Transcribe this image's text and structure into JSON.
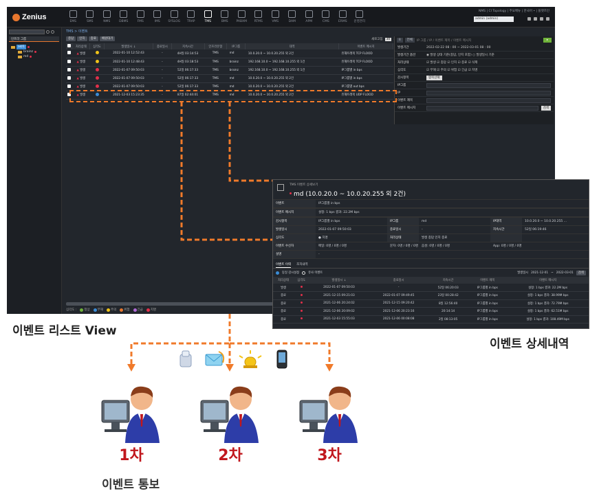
{
  "app": {
    "logo": "Zenius",
    "nav": [
      "EMS",
      "SMS",
      "NMS",
      "DBMS",
      "FMS",
      "IMS",
      "SYSLOG",
      "TRAP",
      "TMS",
      "BMS",
      "PABXM",
      "RTMS",
      "VMS",
      "DAM",
      "APM",
      "CMS",
      "ERMS",
      "운영관리"
    ],
    "active_nav": "TMS",
    "top_links": "NMS | CI Topology | 주요메뉴 | 한국어 • | 플랫즈인",
    "user": "admin (admin)",
    "sidebar_tab": "인프라 그룹",
    "tree": {
      "root": "ad/1",
      "children": [
        "brainz",
        "md"
      ]
    },
    "breadcrumb": "TMS > 이벤트",
    "filter_buttons": [
      "종답",
      "인지",
      "종료",
      "배원대기"
    ],
    "refresh_label": "새로고침",
    "refresh_value": "30",
    "refresh_unit": "초",
    "columns": [
      "처리상태",
      "심각도",
      "발생일시 ↓",
      "종료일시",
      "지속시간",
      "인프라유형",
      "IP그룹",
      "대역",
      "이벤트 메시지"
    ],
    "rows": [
      {
        "status": "발생",
        "color": "#f0c419",
        "time": "2022-01-10 12:52:43",
        "end": "-",
        "dur": "4H일 03:14:53",
        "type": "TMS",
        "ip": "md",
        "band": "10.0.20.0 ~ 10.0.20.255 외 2건",
        "msg": "유해트래픽 TCP FLOOD"
      },
      {
        "status": "발생",
        "color": "#f0c419",
        "time": "2022-01-10 12:48:43",
        "end": "-",
        "dur": "4H일 03:18:53",
        "type": "TMS",
        "ip": "brainz",
        "band": "192.168.10.0 ~ 192.168.10.255 외 1건",
        "msg": "유해트래픽 TCP FLOOD"
      },
      {
        "status": "발생",
        "color": "#e2304a",
        "time": "2022-01-07 09:50:03",
        "end": "-",
        "dur": "52일 06:17:33",
        "type": "TMS",
        "ip": "brainz",
        "band": "192.168.10.0 ~ 192.168.10.255 외 1건",
        "msg": "IP그룹별 in bps"
      },
      {
        "status": "발생",
        "color": "#e2304a",
        "time": "2022-01-07 09:50:03",
        "end": "-",
        "dur": "52일 06:17:33",
        "type": "TMS",
        "ip": "md",
        "band": "10.0.20.0 ~ 10.0.20.255 외 2건",
        "msg": "IP그룹별 in bps"
      },
      {
        "status": "발생",
        "color": "#e2304a",
        "time": "2022-01-07 09:50:03",
        "end": "-",
        "dur": "52일 06:17:33",
        "type": "TMS",
        "ip": "md",
        "band": "10.0.20.0 ~ 10.0.20.255 외 2건",
        "msg": "IP그룹별 out bps"
      },
      {
        "status": "발생",
        "color": "#3b8cd6",
        "time": "2021-12-03 15:23:35",
        "end": "-",
        "dur": "87일 02:44:01",
        "type": "TMS",
        "ip": "md",
        "band": "10.0.20.0 ~ 10.0.20.255 외 2건",
        "msg": "유해트래픽 UDP FLOOD"
      }
    ],
    "legend_label": "심각도 :",
    "legend": [
      {
        "label": "정상",
        "color": "#6fb23a"
      },
      {
        "label": "무해",
        "color": "#3b8cd6"
      },
      {
        "label": "주의",
        "color": "#f0c419"
      },
      {
        "label": "위험",
        "color": "#e8772e"
      },
      {
        "label": "긴급",
        "color": "#b06ad6"
      },
      {
        "label": "치명",
        "color": "#e2304a"
      }
    ]
  },
  "search_panel": {
    "top_filter": "전체",
    "top_placeholder": "IP 그룹 / IP / 이벤트 제목 / 이벤트 메시지",
    "fields": [
      {
        "label": "발생기간",
        "value": "2022-02-22  08 : 00  ~  2022-03-01  08 : 00"
      },
      {
        "label": "발생기간 옵션",
        "value": "◉ 발생 상태 기준(종답, 인지 포함)  ○ 발생일시 기준"
      },
      {
        "label": "처리상태",
        "value": "☑ 발생  ☑ 종답  ☑ 인지  ☑ 종료  ☑ 삭제"
      },
      {
        "label": "심각도",
        "value": "☑ 무해  ☑ 주의  ☑ 위험  ☑ 긴급  ☑ 치명"
      },
      {
        "label": "감시항목",
        "value": "항목선택"
      },
      {
        "label": "IP그룹",
        "value": ""
      },
      {
        "label": "IP",
        "value": ""
      },
      {
        "label": "이벤트 제목",
        "value": ""
      },
      {
        "label": "이벤트 메시지",
        "value": ""
      }
    ],
    "search_button": "검색"
  },
  "detail": {
    "window_title": "TMS 이벤트 상세보기",
    "title": "md (10.0.20.0 ~ 10.0.20.255 외 2건)",
    "rows": [
      [
        "이벤트",
        "IP그룹별 in bps"
      ],
      [
        "이벤트 메시지",
        "설정: 1 bps 결과: 22.2M bps"
      ]
    ],
    "grid": [
      [
        "감시항목",
        "IP그룹별 in bps",
        "IP그룹",
        "md",
        "IP대역",
        "10.0.20.0 ~ 10.0.20.255 ..."
      ],
      [
        "발생일시",
        "2022-01-07 09:50:03",
        "종료일시",
        "-",
        "지속시간",
        "52일 06:19:46"
      ],
      [
        "심각도",
        "● 치명",
        "처리상태",
        "발생  종답  인지  종료",
        "",
        ""
      ],
      [
        "이벤트 수신자",
        "메일: 0명 / 0명 / 0명",
        "문자: 0명 / 0명 / 0명",
        "음성: 0명 / 0명 / 0명",
        "App: 0명 / 0명 / 0명",
        ""
      ],
      [
        "설명",
        "-",
        "",
        "",
        "",
        ""
      ]
    ],
    "tabs": [
      "이벤트 이력",
      "조치내역"
    ],
    "history_filter": {
      "opt1": "동일 감시설정",
      "opt2": "유사 이벤트",
      "date_label": "발생일시",
      "from": "2021-12-01",
      "to": "2022-03-01",
      "search": "검색"
    },
    "history_columns": [
      "처리상태",
      "심각도",
      "발생일시 ↓",
      "종료일시",
      "지속시간",
      "이벤트 제목",
      "이벤트 메시지"
    ],
    "history_rows": [
      [
        "발생",
        "2022-01-07 09:50:03",
        "-",
        "52일 06:20:03",
        "IP그룹별 in bps",
        "설정: 1 bps 결과: 22.2M bps"
      ],
      [
        "종료",
        "2021-12-15 09:21:03",
        "2022-01-07 09:49:45",
        "23일 00:28:42",
        "IP그룹별 in bps",
        "설정: 1 bps 결과: 38.99M bps"
      ],
      [
        "종료",
        "2021-12-06 20:24:02",
        "2021-12-15 09:20:42",
        "8일 12:56:40",
        "IP그룹별 in bps",
        "설정: 1 bps 결과: 72.79M bps"
      ],
      [
        "종료",
        "2021-12-06 20:09:02",
        "2021-12-06 20:23:16",
        "20:14:14",
        "IP그룹별 in bps",
        "설정: 1 bps 결과: 62.51M bps"
      ],
      [
        "종료",
        "2021-12-03 15:55:03",
        "2021-12-06 00:08:08",
        "2일 08:13:05",
        "IP그룹별 in bps",
        "설정: 1 bps 결과: 108.49M bps"
      ]
    ]
  },
  "captions": {
    "event_list": "이벤트 리스트 View",
    "event_detail": "이벤트 상세내역",
    "event_notify": "이벤트 통보"
  },
  "steps": [
    "1차",
    "2차",
    "3차"
  ],
  "colors": {
    "accent": "#f07a2a",
    "step": "#c0171d"
  }
}
